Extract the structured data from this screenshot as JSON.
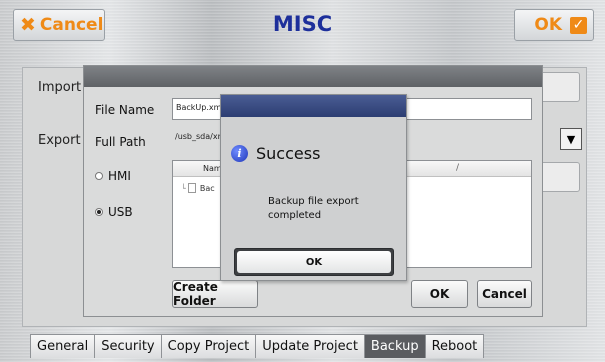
{
  "header": {
    "cancel_label": "Cancel",
    "title": "MISC",
    "ok_label": "OK"
  },
  "panel": {
    "import_label": "Import",
    "export_label": "Export"
  },
  "file_dialog": {
    "file_name_label": "File Name",
    "file_name_value": "BackUp.xm",
    "full_path_label": "Full Path",
    "full_path_value": "/usb_sda/xm",
    "radio_hmi": "HMI",
    "radio_usb": "USB",
    "selected_storage": "USB",
    "list_header_name": "Name",
    "list_header_sep": "/",
    "list_item": "Bac",
    "create_folder_label": "Create Folder",
    "ok_label": "OK",
    "cancel_label": "Cancel"
  },
  "success_modal": {
    "title": "Success",
    "message": "Backup file export completed",
    "ok_label": "OK"
  },
  "tabs": [
    {
      "label": "General"
    },
    {
      "label": "Security"
    },
    {
      "label": "Copy Project"
    },
    {
      "label": "Update Project"
    },
    {
      "label": "Backup"
    },
    {
      "label": "Reboot"
    }
  ],
  "active_tab": "Backup",
  "colors": {
    "accent_orange": "#ef8a17",
    "title_blue": "#1d2f9b",
    "active_tab": "#5a5c60",
    "modal_titlebar": "#2c3d72"
  }
}
